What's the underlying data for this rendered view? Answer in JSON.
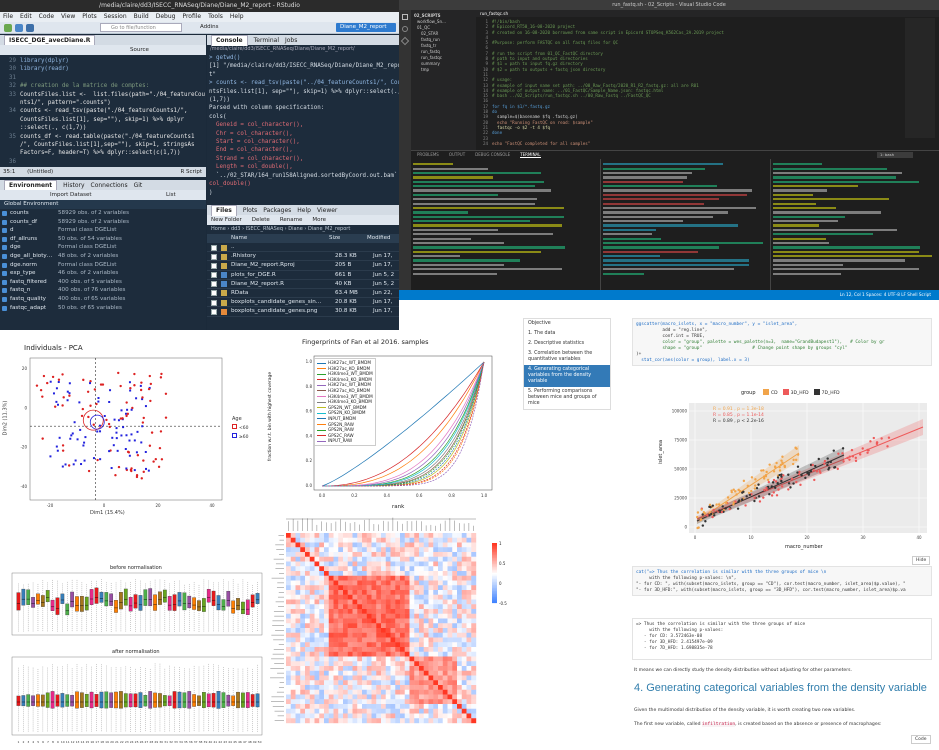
{
  "rstudio": {
    "title": "/media/claire/dd3/ISECC_RNASeq/Diane/Diane_M2_report - RStudio",
    "menu": [
      "File",
      "Edit",
      "Code",
      "View",
      "Plots",
      "Session",
      "Build",
      "Debug",
      "Profile",
      "Tools",
      "Help"
    ],
    "goto": "Go to file/function",
    "addins": "Addins",
    "project": "Diane_M2_report",
    "editor_tab": "ISECC_DGE_avecDiane.R",
    "source_btn": "Source",
    "code_lines": [
      {
        "n": "29",
        "t": "library(dplyr)"
      },
      {
        "n": "30",
        "t": "library(readr)"
      },
      {
        "n": "31",
        "t": ""
      },
      {
        "n": "32",
        "t": "## creation de la matrice de comptes:"
      },
      {
        "n": "33",
        "t": "CountsFiles.list <-  list.files(path=\"./04_featureCou"
      },
      {
        "n": "",
        "t": "nts1/\", pattern=\".counts\")"
      },
      {
        "n": "34",
        "t": "counts <- read_tsv(paste(\"./04_featureCounts1/\","
      },
      {
        "n": "",
        "t": "CountsFiles.list[1], sep=\"\"), skip=1) %>% dplyr"
      },
      {
        "n": "",
        "t": "::select(., c(1,7))"
      },
      {
        "n": "35",
        "t": "counts_df <- read.table(paste(\"./04_featureCounts1"
      },
      {
        "n": "",
        "t": "/\", CountsFiles.list[1],sep=\"\"), skip=1, stringsAs"
      },
      {
        "n": "",
        "t": "Factors=F, header=T) %>% dplyr::select(c(1,7))"
      },
      {
        "n": "36",
        "t": ""
      }
    ],
    "editor_status": "35:1",
    "editor_scope": "(Untitled)",
    "editor_lang": "R Script",
    "console_tabs": [
      "Console",
      "Terminal",
      "Jobs"
    ],
    "console_path": "/media/claire/dd3/ISECC_RNASeq/Diane/Diane_M2_report/",
    "console_lines": [
      "> getwd()",
      "[1] \"/media/claire/dd3/ISECC_RNASeq/Diane/Diane_M2_repor",
      "t\"",
      "> counts <- read_tsv(paste(\"../04_featureCounts1/\", Cou",
      "ntsFiles.list[1], sep=\"\"), skip=1) %>% dplyr::select(., c",
      "(1,7))",
      "Parsed with column specification:",
      "cols(",
      "  Geneid = col_character(),",
      "  Chr = col_character(),",
      "  Start = col_character(),",
      "  End = col_character(),",
      "  Strand = col_character(),",
      "  Length = col_double(),",
      "  `../02_STAR/164_run158Aligned.sortedByCoord.out.bam` =",
      "col_double()",
      ")"
    ],
    "env_tabs": [
      "Environment",
      "History",
      "Connections",
      "Git"
    ],
    "import_label": "Import Dataset",
    "list_label": "List",
    "global_env": "Global Environment",
    "env_rows": [
      {
        "name": "counts",
        "value": "58929 obs. of 2 variables"
      },
      {
        "name": "counts_df",
        "value": "58929 obs. of 2 variables"
      },
      {
        "name": "d",
        "value": "Formal class DGEList"
      },
      {
        "name": "df_allruns",
        "value": "50 obs. of 54 variables"
      },
      {
        "name": "dge",
        "value": "Formal class DGEList"
      },
      {
        "name": "dge_all_bioty…",
        "value": "48 obs. of 2 variables"
      },
      {
        "name": "dge.norm",
        "value": "Formal class DGEList"
      },
      {
        "name": "exp_type",
        "value": "46 obs. of 2 variables"
      },
      {
        "name": "fastq_filtered",
        "value": "400 obs. of 5 variables"
      },
      {
        "name": "fastq_n",
        "value": "400 obs. of 76 variables"
      },
      {
        "name": "fastq_quality",
        "value": "400 obs. of 65 variables"
      },
      {
        "name": "fastqc_adapt",
        "value": "50 obs. of 65 variables"
      }
    ],
    "files_tabs": [
      "Files",
      "Plots",
      "Packages",
      "Help",
      "Viewer"
    ],
    "files_actions": [
      "New Folder",
      "Delete",
      "Rename",
      "More"
    ],
    "files_path": [
      "Home",
      "dd3",
      "ISECC_RNASeq",
      "Diane",
      "Diane_M2_report"
    ],
    "files_cols": [
      "Name",
      "Size",
      "Modified"
    ],
    "files": [
      {
        "name": "..",
        "size": "",
        "mod": ""
      },
      {
        "name": ".Rhistory",
        "size": "28.3 KB",
        "mod": "Jun 17,"
      },
      {
        "name": "Diane_M2_report.Rproj",
        "size": "205 B",
        "mod": "Jun 17,"
      },
      {
        "name": "plots_for_DGE.R",
        "size": "661 B",
        "mod": "Jun 5, 2"
      },
      {
        "name": "Diane_M2_report.R",
        "size": "40 KB",
        "mod": "Jun 5, 2"
      },
      {
        "name": "RData",
        "size": "63.4 MB",
        "mod": "Jun 22,"
      },
      {
        "name": "boxplots_candidate_genes_sin…",
        "size": "20.8 KB",
        "mod": "Jun 17,"
      },
      {
        "name": "boxplots_candidate_genes.png",
        "size": "30.8 KB",
        "mod": "Jun 17,"
      }
    ]
  },
  "vscode": {
    "title": "run_fastq.sh - 02_Scripts - Visual Studio Code",
    "tab": "run_fastqc.sh",
    "explorer_items": [
      "02_SCRIPTS",
      "workflow_Sn…",
      "01_QC",
      "02_STAR",
      "fastq_run",
      "fastq_tr",
      "run_fastq",
      "run_fastqc",
      "summary",
      "tmp"
    ],
    "code_lines": [
      {
        "t": "#!/bin/bash",
        "c": "vc"
      },
      {
        "t": "# Epicord_RT50_16-08-2020 project",
        "c": "vc"
      },
      {
        "t": "# created on 16-08-2020 borrowed from same script in Epicord STOPSeq_K562Cas_2A.2019 project",
        "c": "vc"
      },
      {
        "t": "",
        "c": ""
      },
      {
        "t": "#Purpose: perform FASTQC on all fastq files for QC",
        "c": "vc"
      },
      {
        "t": "",
        "c": ""
      },
      {
        "t": "# run the script from 01_QC_FastQC directory",
        "c": "vc"
      },
      {
        "t": "# path to input and output directories",
        "c": "vc"
      },
      {
        "t": "# $1 = path to input fq.gz directory",
        "c": "vc"
      },
      {
        "t": "# $2 = path to outputs + fastq json directory",
        "c": "vc"
      },
      {
        "t": "",
        "c": ""
      },
      {
        "t": "# usage:",
        "c": "vc"
      },
      {
        "t": "# example of input name set path: ../00_Raw_Fastq/2020_R1_R2_fastq.gz: all are R01",
        "c": "vc"
      },
      {
        "t": "# example of output name: ../01_FastQC/Sample_Name.json: fastqc.html",
        "c": "vc"
      },
      {
        "t": "# bash ../02_Scripts/run_fastqc.sh ../00_Raw_Fastq ../FastQC_QC",
        "c": "vc"
      },
      {
        "t": "",
        "c": ""
      },
      {
        "t": "for fq in $1/*.fastq.gz",
        "c": "vk"
      },
      {
        "t": "do",
        "c": "vk"
      },
      {
        "t": "  sample=$(basename $fq .fastq.gz)",
        "c": ""
      },
      {
        "t": "  echo \"Running FastQC on read: $sample\"",
        "c": "vs"
      },
      {
        "t": "  fastqc -o $2 -t 4 $fq",
        "c": "vf"
      },
      {
        "t": "done",
        "c": "vk"
      },
      {
        "t": "",
        "c": ""
      },
      {
        "t": "echo \"FastQC completed for all samples\"",
        "c": "vs"
      }
    ],
    "panel_tabs": [
      "PROBLEMS",
      "OUTPUT",
      "DEBUG CONSOLE",
      "TERMINAL"
    ],
    "terminal_select": "1: bash",
    "status_left": "master",
    "status_right": "Ln 12, Col 1   Spaces: 4   UTF-8   LF   Shell Script"
  },
  "pca": {
    "title": "Individuals - PCA",
    "xlabel": "Dim1 (15.4%)",
    "ylabel": "Dim2 (11.3%)",
    "legend_title": "Age",
    "legend": [
      "<60",
      "≥60"
    ],
    "xticks": [
      "-20",
      "0",
      "20",
      "40"
    ],
    "yticks": [
      "-40",
      "-20",
      "0",
      "20"
    ]
  },
  "fingerprint": {
    "title": "Fingerprints of Fan et al 2016. samples",
    "xlabel": "rank",
    "ylabel": "fraction w.r.t. bin with highest coverage",
    "xticks": [
      "0.0",
      "0.2",
      "0.4",
      "0.6",
      "0.8",
      "1.0"
    ],
    "yticks": [
      "0.0",
      "0.2",
      "0.4",
      "0.6",
      "0.8",
      "1.0"
    ],
    "legend": [
      {
        "name": "H3K27ac_WT_BMDM",
        "color": "#1f77b4"
      },
      {
        "name": "H3K27ac_KO_BMDM",
        "color": "#ff7f0e"
      },
      {
        "name": "H3K4me3_WT_BMDM",
        "color": "#2ca02c"
      },
      {
        "name": "H3K4me3_KO_BMDM",
        "color": "#d62728"
      },
      {
        "name": "H3K27ac_WT_BMDM",
        "color": "#9467bd"
      },
      {
        "name": "H3K27ac_KO_BMDM",
        "color": "#8c564b"
      },
      {
        "name": "H3K4me3_WT_BMDM",
        "color": "#e377c2"
      },
      {
        "name": "H3K4me3_KO_BMDM",
        "color": "#7f7f7f"
      },
      {
        "name": "GPS2N_WT_BMDM",
        "color": "#bcbd22"
      },
      {
        "name": "GPS2N_KO_BMDM",
        "color": "#17becf"
      },
      {
        "name": "INPUT_BMDM",
        "color": "#1f77b4"
      },
      {
        "name": "GPS2N_RAW",
        "color": "#ff7f0e"
      },
      {
        "name": "GPS2N_RAW",
        "color": "#2ca02c"
      },
      {
        "name": "GPS2C_RAW",
        "color": "#d62728"
      },
      {
        "name": "INPUT_RAW",
        "color": "#9467bd"
      }
    ]
  },
  "heatmap": {
    "scale": [
      "1",
      "0.5",
      "0",
      "-0.5"
    ]
  },
  "boxplots": {
    "top_title": "before normalisation",
    "bottom_title": "after normalisation",
    "xticks": [
      "1",
      "2",
      "3",
      "4",
      "5",
      "6",
      "7",
      "8",
      "9",
      "10",
      "11",
      "12",
      "13",
      "14",
      "15",
      "16",
      "17",
      "18",
      "19",
      "20",
      "21",
      "22",
      "23",
      "24",
      "25",
      "26",
      "27",
      "28",
      "29",
      "30",
      "31",
      "32",
      "33",
      "34",
      "35",
      "36",
      "37",
      "38",
      "39",
      "40",
      "41",
      "42",
      "43",
      "44",
      "45",
      "46",
      "47",
      "48",
      "49",
      "50"
    ]
  },
  "notebook": {
    "toc": [
      {
        "label": "Objective",
        "active": false
      },
      {
        "label": "1. The data",
        "active": false
      },
      {
        "label": "2. Descriptive statistics",
        "active": false
      },
      {
        "label": "3. Correlation between the quantitative variables",
        "active": false
      },
      {
        "label": "4. Generating categorical variables from the density variable",
        "active": true
      },
      {
        "label": "5. Performing comparisons between mice and groups of mice",
        "active": false
      }
    ],
    "code1": [
      "ggscatter(macro_islets, x = \"macro_number\", y = \"islet_area\",",
      "          add = \"reg.line\",",
      "          conf.int = TRUE,",
      "          color = \"group\", palette = wes_palette(n=3,  name=\"GrandBudapest1\"),   # Color by gr",
      "          shape = \"group\"                   # Change point shape by groups \"cyl\"",
      ")+",
      "  stat_cor(aes(color = group), label.x = 3)"
    ],
    "scatter": {
      "legend_title": "group",
      "legend": [
        {
          "name": "CD",
          "color": "#f1a44a"
        },
        {
          "name": "3D_HFD",
          "color": "#ee5a5a"
        },
        {
          "name": "7D_HFD",
          "color": "#333333"
        }
      ],
      "ylabel": "islet_area",
      "xlabel": "macro_number",
      "yticks": [
        "100000",
        "75000",
        "50000",
        "25000",
        "0"
      ],
      "xticks": [
        "0",
        "10",
        "20",
        "30",
        "40"
      ],
      "stats": [
        {
          "text": "R = 0.91 , p = 1.3e-18",
          "color": "#f1a44a"
        },
        {
          "text": "R = 0.85 , p = 1.1e-14",
          "color": "#ee5a5a"
        },
        {
          "text": "R = 0.89 , p < 2.2e-16",
          "color": "#333333"
        }
      ]
    },
    "hide": "Hide",
    "code2": [
      "cat(\"=> Thus the correlation is similar with the three groups of mice \\n",
      "     with the following p-values: \\n\",",
      "\"- for CD: \", with(subset(macro_islets, group == \"CD\"), cor.test(macro_number, islet_area)$p.value), \"",
      "\"- for 3D_HFD:\", with(subset(macro_islets, group == \"3D_HFD\"), cor.test(macro_number, islet_area)$p.va"
    ],
    "output": [
      "=> Thus the correlation is similar with the three groups of mice",
      "",
      "     with the following p-values:",
      "   - for CD: 3.572463e-08",
      "   - for 3D_HFD: 2.415497e-09",
      "   - for 7D_HFD: 1.698835e-78"
    ],
    "note": "It means we can directly study the density distribution without adjusting for other parameters.",
    "heading": "4. Generating categorical variables from the density variable",
    "para1": "Given the multimodal distribution of the density variable, it is worth creating two new variables.",
    "para2_a": "The first new variable, called",
    "para2_code": "infiltration",
    "para2_b": ", is created based on the absence or presence of macrophages:",
    "code_btn": "Code"
  }
}
